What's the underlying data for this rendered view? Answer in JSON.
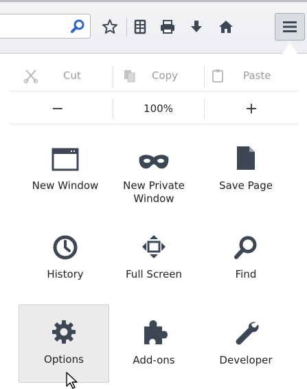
{
  "toolbar": {
    "search_icon": "magnifier-icon",
    "buttons": [
      "bookmark-star-icon",
      "reading-list-icon",
      "print-icon",
      "download-icon",
      "home-icon",
      "hamburger-menu-icon"
    ]
  },
  "edit": {
    "cut_label": "Cut",
    "copy_label": "Copy",
    "paste_label": "Paste"
  },
  "zoom": {
    "minus_label": "−",
    "value": "100%",
    "plus_label": "+"
  },
  "menu_items": {
    "new_window": "New Window",
    "new_private_window": "New Private Window",
    "save_page": "Save Page",
    "history": "History",
    "full_screen": "Full Screen",
    "find": "Find",
    "options": "Options",
    "add_ons": "Add-ons",
    "developer": "Developer"
  },
  "colors": {
    "icon": "#3d4654",
    "selected_bg": "#ebebeb",
    "disabled_text": "#9a9a9a"
  }
}
